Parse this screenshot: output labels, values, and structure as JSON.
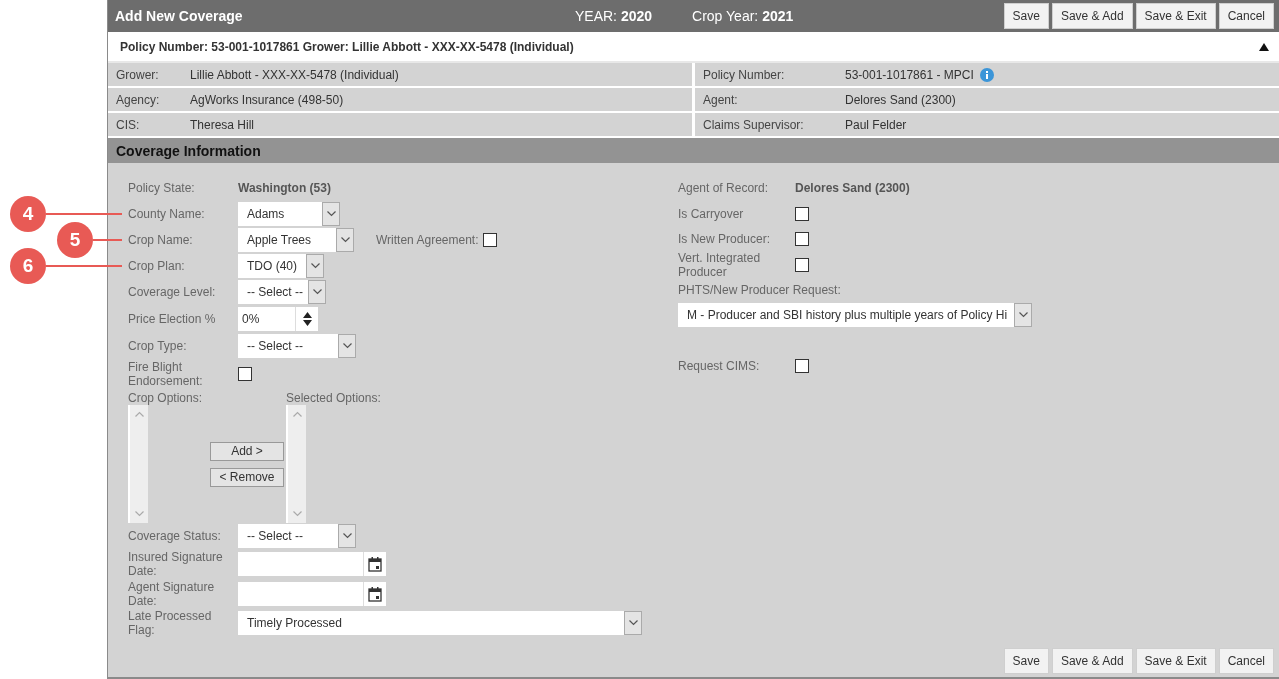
{
  "header": {
    "title": "Add New Coverage",
    "year_label": "YEAR:",
    "year": "2020",
    "crop_year_label": "Crop Year:",
    "crop_year": "2021",
    "buttons": [
      "Save",
      "Save & Add",
      "Save & Exit",
      "Cancel"
    ]
  },
  "summary_bar": {
    "text": "Policy Number: 53-001-1017861 Grower: Lillie Abbott - XXX-XX-5478 (Individual)",
    "expanded": true
  },
  "info_rows": [
    {
      "left": {
        "label": "Grower:",
        "value": "Lillie Abbott - XXX-XX-5478 (Individual)"
      },
      "right": {
        "label": "Policy Number:",
        "value": "53-001-1017861 - MPCI",
        "info": true
      }
    },
    {
      "left": {
        "label": "Agency:",
        "value": "AgWorks Insurance (498-50)"
      },
      "right": {
        "label": "Agent:",
        "value": "Delores Sand (2300)",
        "info": false
      }
    },
    {
      "left": {
        "label": "CIS:",
        "value": "Theresa Hill"
      },
      "right": {
        "label": "Claims Supervisor:",
        "value": "Paul Felder",
        "info": false
      }
    }
  ],
  "section_title": "Coverage Information",
  "left_fields": [
    {
      "kind": "static",
      "label": "Policy State:",
      "value": "Washington (53)"
    },
    {
      "kind": "select",
      "label": "County Name:",
      "value": "Adams",
      "callout": "4"
    },
    {
      "kind": "select",
      "label": "Crop Name:",
      "value": "Apple Trees",
      "callout": "5",
      "extra": {
        "label": "Written Agreement:",
        "checked": false
      }
    },
    {
      "kind": "select",
      "label": "Crop Plan:",
      "value": "TDO (40)",
      "callout": "6"
    },
    {
      "kind": "select",
      "label": "Coverage Level:",
      "value": "-- Select --"
    },
    {
      "kind": "spinner",
      "label": "Price Election %",
      "value": "0%"
    },
    {
      "kind": "select",
      "label": "Crop Type:",
      "value": "-- Select --"
    },
    {
      "kind": "checkbox",
      "label": "Fire Blight Endorsement:",
      "checked": false
    },
    {
      "kind": "transfer",
      "label": "Crop Options:",
      "selected_label": "Selected Options:",
      "buttons": [
        "Add >",
        "< Remove"
      ]
    },
    {
      "kind": "select",
      "label": "Coverage Status:",
      "value": "-- Select --"
    },
    {
      "kind": "date",
      "label": "Insured Signature Date:"
    },
    {
      "kind": "date",
      "label": "Agent Signature Date:"
    },
    {
      "kind": "select",
      "label": "Late Processed Flag:",
      "value": "Timely Processed"
    }
  ],
  "right_fields": [
    {
      "kind": "static",
      "label": "Agent of Record:",
      "value": "Delores Sand (2300)"
    },
    {
      "kind": "checkbox",
      "label": "Is Carryover",
      "checked": false
    },
    {
      "kind": "checkbox",
      "label": "Is New Producer:",
      "checked": false
    },
    {
      "kind": "checkbox",
      "label": "Vert. Integrated Producer",
      "checked": false
    },
    {
      "kind": "select_block",
      "label": "PHTS/New Producer Request:",
      "value": "M - Producer and SBI history plus multiple years of Policy Hi"
    },
    {
      "kind": "checkbox",
      "label": "Request CIMS:",
      "checked": false
    }
  ],
  "footer_buttons": [
    "Save",
    "Save & Add",
    "Save & Exit",
    "Cancel"
  ]
}
